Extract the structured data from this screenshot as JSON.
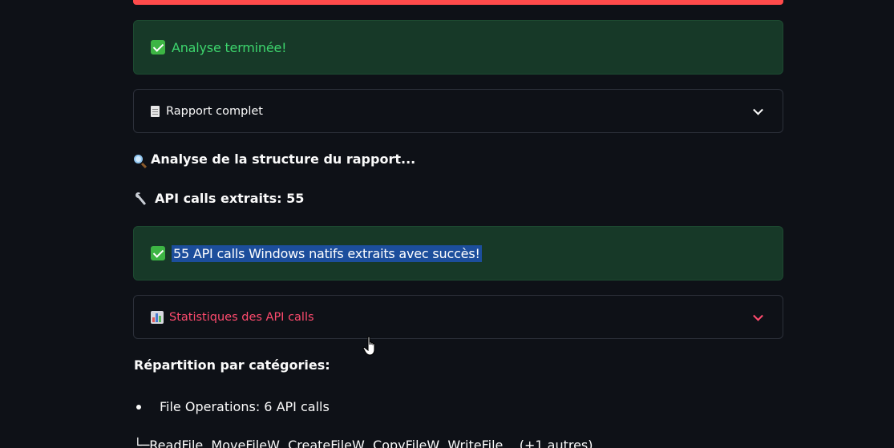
{
  "status": {
    "analysis_done": "Analyse terminée!",
    "api_success": "55 API calls Windows natifs extraits avec succès!"
  },
  "expanders": {
    "report": {
      "label": "Rapport complet",
      "icon": "document-icon"
    },
    "stats": {
      "label": "Statistiques des API calls",
      "icon": "bar-chart-icon"
    }
  },
  "messages": {
    "structure": "Analyse de la structure du rapport...",
    "api_count": "API calls extraits: 55"
  },
  "breakdown": {
    "heading": "Répartition par catégories:",
    "items": [
      {
        "label": "File Operations: 6 API calls"
      }
    ],
    "tree_line": "└─ReadFile, MoveFileW, CreateFileW, CopyFileW, WriteFile... (+1 autres)"
  },
  "colors": {
    "background": "#0e1117",
    "accent": "#ff4b4b",
    "success_bg": "#173928",
    "success_text": "#3dd56d",
    "selection": "#1c4e9c"
  }
}
